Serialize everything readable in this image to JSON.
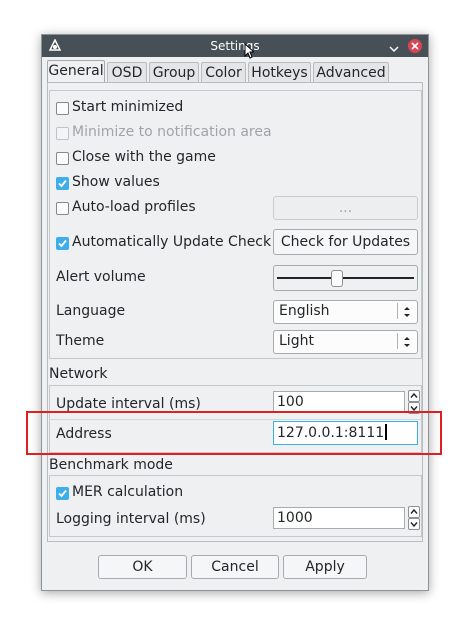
{
  "window": {
    "title": "Settings"
  },
  "tabs": [
    {
      "label": "General"
    },
    {
      "label": "OSD"
    },
    {
      "label": "Group"
    },
    {
      "label": "Color"
    },
    {
      "label": "Hotkeys"
    },
    {
      "label": "Advanced"
    }
  ],
  "general": {
    "start_minimized": {
      "label": "Start minimized",
      "checked": false
    },
    "minimize_notification": {
      "label": "Minimize to notification area",
      "checked": false,
      "enabled": false
    },
    "close_with_game": {
      "label": "Close with the game",
      "checked": false
    },
    "show_values": {
      "label": "Show values",
      "checked": true
    },
    "auto_load": {
      "label": "Auto-load profiles",
      "checked": false
    },
    "profiles_button": "...",
    "auto_update": {
      "label": "Automatically Update Check",
      "checked": true
    },
    "check_updates_button": "Check for Updates",
    "alert_volume": {
      "label": "Alert volume",
      "level": 0.43
    },
    "language": {
      "label": "Language",
      "value": "English"
    },
    "theme": {
      "label": "Theme",
      "value": "Light"
    }
  },
  "network": {
    "title": "Network",
    "update_interval": {
      "label": "Update interval (ms)",
      "value": "100"
    },
    "address": {
      "label": "Address",
      "value": "127.0.0.1:8111"
    }
  },
  "benchmark": {
    "title": "Benchmark mode",
    "mer": {
      "label": "MER calculation",
      "checked": true
    },
    "logging_interval": {
      "label": "Logging interval (ms)",
      "value": "1000"
    }
  },
  "buttons": {
    "ok": "OK",
    "cancel": "Cancel",
    "apply": "Apply"
  },
  "colors": {
    "accent": "#3daee9",
    "titlebar": "#475057",
    "close": "#da4453",
    "highlight": "#e02020"
  }
}
